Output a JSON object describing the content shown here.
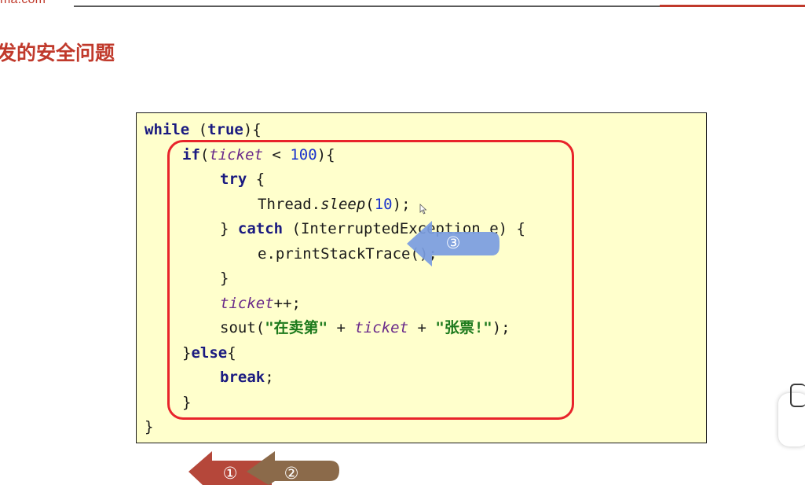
{
  "header": {
    "site_url": "ma.com",
    "title": "发的安全问题"
  },
  "code": {
    "lines": [
      [
        {
          "t": "while",
          "c": "kw"
        },
        {
          "t": " (",
          "c": ""
        },
        {
          "t": "true",
          "c": "kw"
        },
        {
          "t": "){",
          "c": ""
        }
      ],
      [
        {
          "t": "if",
          "c": "kw"
        },
        {
          "t": "(",
          "c": ""
        },
        {
          "t": "ticket",
          "c": "var"
        },
        {
          "t": " < ",
          "c": ""
        },
        {
          "t": "100",
          "c": "num"
        },
        {
          "t": "){",
          "c": ""
        }
      ],
      [
        {
          "t": "try",
          "c": "kw"
        },
        {
          "t": " {",
          "c": ""
        }
      ],
      [
        {
          "t": "Thread.",
          "c": ""
        },
        {
          "t": "sleep",
          "c": "mth"
        },
        {
          "t": "(",
          "c": ""
        },
        {
          "t": "10",
          "c": "num"
        },
        {
          "t": ");",
          "c": ""
        }
      ],
      [
        {
          "t": "} ",
          "c": ""
        },
        {
          "t": "catch",
          "c": "kw"
        },
        {
          "t": " (InterruptedException e) {",
          "c": ""
        }
      ],
      [
        {
          "t": "e.printStackTrace();",
          "c": ""
        }
      ],
      [
        {
          "t": "}",
          "c": ""
        }
      ],
      [
        {
          "t": "ticket",
          "c": "var"
        },
        {
          "t": "++;",
          "c": ""
        }
      ],
      [
        {
          "t": "sout(",
          "c": ""
        },
        {
          "t": "\"在卖第\"",
          "c": "str"
        },
        {
          "t": " + ",
          "c": ""
        },
        {
          "t": "ticket",
          "c": "var"
        },
        {
          "t": " + ",
          "c": ""
        },
        {
          "t": "\"张票!\"",
          "c": "str"
        },
        {
          "t": ");",
          "c": ""
        }
      ],
      [
        {
          "t": "}",
          "c": ""
        },
        {
          "t": "else",
          "c": "kw"
        },
        {
          "t": "{",
          "c": ""
        }
      ],
      [
        {
          "t": "break",
          "c": "kw"
        },
        {
          "t": ";",
          "c": ""
        }
      ],
      [
        {
          "t": "}",
          "c": ""
        }
      ],
      [
        {
          "t": "}",
          "c": ""
        }
      ]
    ],
    "indents": [
      0,
      1,
      2,
      3,
      2,
      3,
      2,
      2,
      2,
      1,
      2,
      1,
      0
    ]
  },
  "annotations": {
    "arrow1_label": "①",
    "arrow2_label": "②",
    "arrow3_label": "③",
    "arrow1_color": "#b5473a",
    "arrow2_color": "#8b6a4a",
    "arrow3_color": "#7b9de0",
    "highlight_color": "#e8242b"
  }
}
